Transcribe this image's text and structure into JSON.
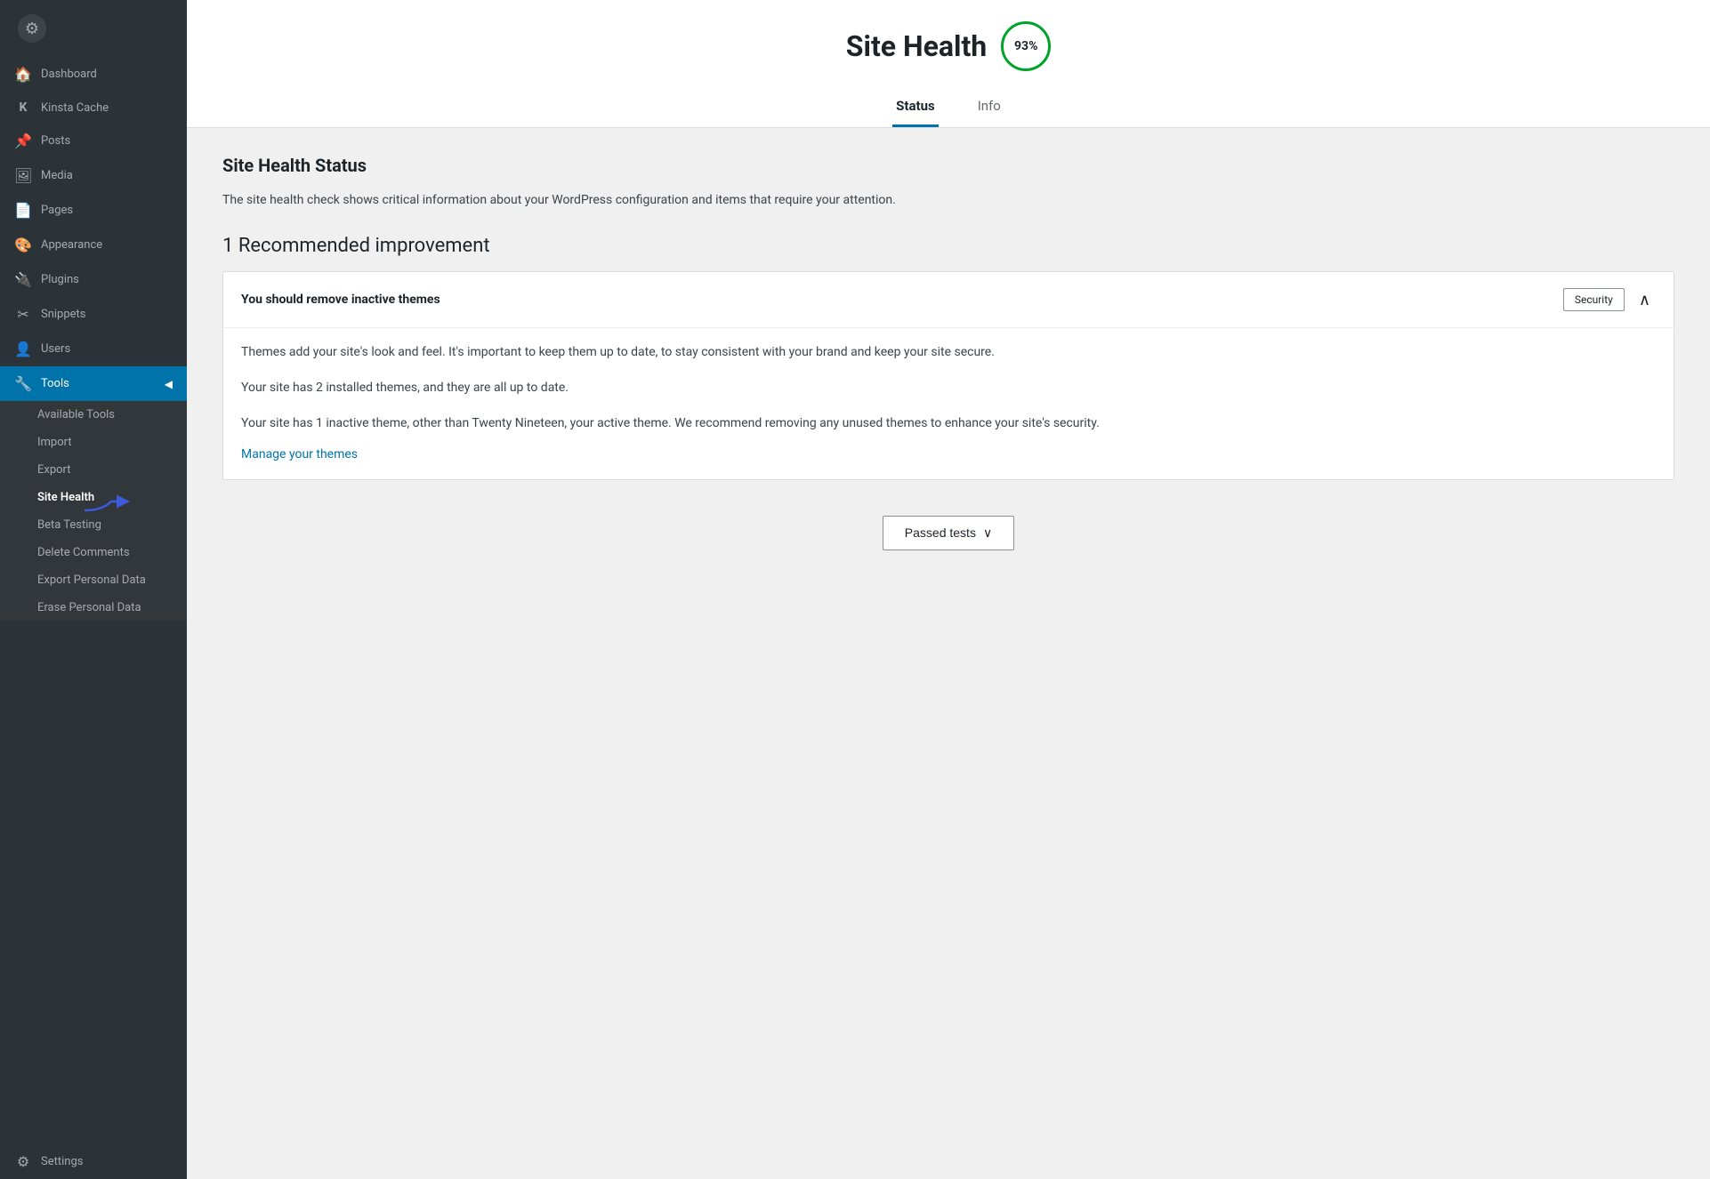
{
  "sidebar": {
    "items": [
      {
        "id": "dashboard",
        "label": "Dashboard",
        "icon": "🏠",
        "active": false
      },
      {
        "id": "kinsta-cache",
        "label": "Kinsta Cache",
        "icon": "K",
        "active": false
      },
      {
        "id": "posts",
        "label": "Posts",
        "icon": "📌",
        "active": false
      },
      {
        "id": "media",
        "label": "Media",
        "icon": "🖼",
        "active": false
      },
      {
        "id": "pages",
        "label": "Pages",
        "icon": "📄",
        "active": false
      },
      {
        "id": "appearance",
        "label": "Appearance",
        "icon": "🎨",
        "active": false
      },
      {
        "id": "plugins",
        "label": "Plugins",
        "icon": "🔌",
        "active": false
      },
      {
        "id": "snippets",
        "label": "Snippets",
        "icon": "✂",
        "active": false
      },
      {
        "id": "users",
        "label": "Users",
        "icon": "👤",
        "active": false
      },
      {
        "id": "tools",
        "label": "Tools",
        "icon": "🔧",
        "active": true
      },
      {
        "id": "settings",
        "label": "Settings",
        "icon": "⚙",
        "active": false
      }
    ],
    "submenu": {
      "parent": "tools",
      "items": [
        {
          "id": "available-tools",
          "label": "Available Tools",
          "active": false
        },
        {
          "id": "import",
          "label": "Import",
          "active": false
        },
        {
          "id": "export",
          "label": "Export",
          "active": false
        },
        {
          "id": "site-health",
          "label": "Site Health",
          "active": true
        },
        {
          "id": "beta-testing",
          "label": "Beta Testing",
          "active": false
        },
        {
          "id": "delete-comments",
          "label": "Delete Comments",
          "active": false
        },
        {
          "id": "export-personal-data",
          "label": "Export Personal Data",
          "active": false
        },
        {
          "id": "erase-personal-data",
          "label": "Erase Personal Data",
          "active": false
        }
      ]
    }
  },
  "header": {
    "title": "Site Health",
    "score": "93%",
    "tabs": [
      {
        "id": "status",
        "label": "Status",
        "active": true
      },
      {
        "id": "info",
        "label": "Info",
        "active": false
      }
    ]
  },
  "content": {
    "section_title": "Site Health Status",
    "section_description": "The site health check shows critical information about your WordPress configuration and items that require your attention.",
    "recommended_title": "1 Recommended improvement",
    "card": {
      "title": "You should remove inactive themes",
      "badge": "Security",
      "paragraphs": [
        "Themes add your site's look and feel. It's important to keep them up to date, to stay consistent with your brand and keep your site secure.",
        "Your site has 2 installed themes, and they are all up to date.",
        "Your site has 1 inactive theme, other than Twenty Nineteen, your active theme. We recommend removing any unused themes to enhance your site's security."
      ],
      "link_text": "Manage your themes",
      "link_href": "#"
    },
    "passed_tests_btn": "Passed tests"
  }
}
